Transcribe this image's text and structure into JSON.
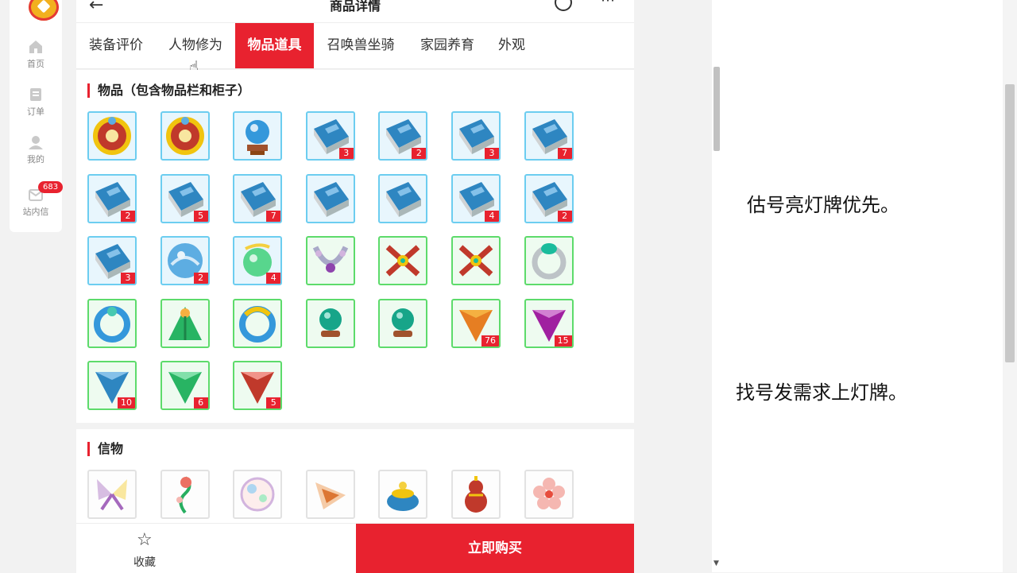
{
  "page": {
    "title": "商品详情"
  },
  "sidebar": {
    "items": [
      {
        "label": "首页",
        "icon": "home-icon"
      },
      {
        "label": "订单",
        "icon": "order-icon"
      },
      {
        "label": "我的",
        "icon": "user-icon"
      },
      {
        "label": "站内信",
        "icon": "message-icon",
        "badge": "683"
      }
    ]
  },
  "tabs": [
    {
      "label": "装备评价",
      "active": false
    },
    {
      "label": "人物修为",
      "active": false
    },
    {
      "label": "物品道具",
      "active": true
    },
    {
      "label": "召唤兽坐骑",
      "active": false
    },
    {
      "label": "家园养育",
      "active": false
    },
    {
      "label": "外观",
      "active": false
    }
  ],
  "items_section": {
    "title": "物品（包含物品栏和柜子）",
    "items": [
      {
        "icon": "gold-ring-icon",
        "count": ""
      },
      {
        "icon": "gold-ring-icon",
        "count": ""
      },
      {
        "icon": "crystal-orb-icon",
        "count": ""
      },
      {
        "icon": "book-icon",
        "count": "3"
      },
      {
        "icon": "book-icon",
        "count": "2"
      },
      {
        "icon": "book-icon",
        "count": "3"
      },
      {
        "icon": "book-icon",
        "count": "7"
      },
      {
        "icon": "book-icon",
        "count": "2"
      },
      {
        "icon": "book-icon",
        "count": "5"
      },
      {
        "icon": "book-icon",
        "count": "7"
      },
      {
        "icon": "book-icon",
        "count": ""
      },
      {
        "icon": "book-icon",
        "count": ""
      },
      {
        "icon": "book-icon",
        "count": "4"
      },
      {
        "icon": "book-icon",
        "count": "2"
      },
      {
        "icon": "book-icon",
        "count": "3"
      },
      {
        "icon": "water-orb-icon",
        "count": "2"
      },
      {
        "icon": "green-orb-icon",
        "count": "4"
      },
      {
        "icon": "silver-necklace-icon",
        "count": ""
      },
      {
        "icon": "gold-necklace-icon",
        "count": ""
      },
      {
        "icon": "gold-necklace-icon",
        "count": ""
      },
      {
        "icon": "jade-ring-icon",
        "count": ""
      },
      {
        "icon": "blue-bracelet-icon",
        "count": ""
      },
      {
        "icon": "green-cloak-icon",
        "count": ""
      },
      {
        "icon": "gold-bracelet-icon",
        "count": ""
      },
      {
        "icon": "jade-orb-icon",
        "count": ""
      },
      {
        "icon": "jade-orb-icon",
        "count": ""
      },
      {
        "icon": "orange-gem-icon",
        "count": "76"
      },
      {
        "icon": "purple-gem-icon",
        "count": "15"
      },
      {
        "icon": "blue-gem-icon",
        "count": "10"
      },
      {
        "icon": "green-gem-icon",
        "count": "6"
      },
      {
        "icon": "red-gem-icon",
        "count": "5"
      }
    ],
    "green_border_from": 17
  },
  "keepsake_section": {
    "title": "信物",
    "items": [
      {
        "icon": "butterfly-icon"
      },
      {
        "icon": "flower-vine-icon"
      },
      {
        "icon": "bubble-icon"
      },
      {
        "icon": "conch-shell-icon"
      },
      {
        "icon": "treasure-pot-icon"
      },
      {
        "icon": "gourd-icon"
      },
      {
        "icon": "blossom-icon"
      }
    ]
  },
  "bottom": {
    "favorite_label": "收藏",
    "buy_label": "立即购买"
  },
  "notes": [
    "估号亮灯牌优先。",
    "找号发需求上灯牌。"
  ],
  "colors": {
    "accent": "#e8222f",
    "blue_border": "#6ccdf0",
    "green_border": "#5ddb6b"
  }
}
